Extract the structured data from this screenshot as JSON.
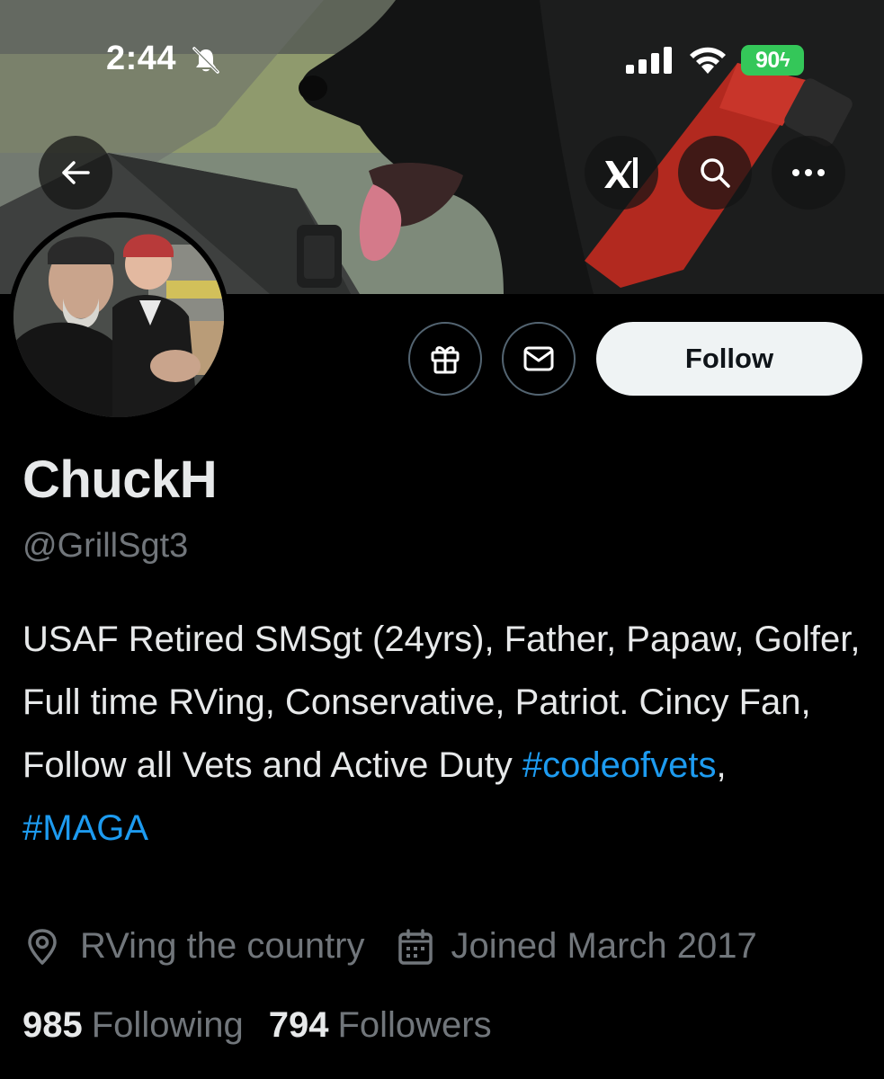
{
  "status_bar": {
    "time": "2:44",
    "battery": "90"
  },
  "banner": {
    "icons": [
      "back-arrow-icon",
      "grok-icon",
      "search-icon",
      "more-icon"
    ]
  },
  "actions": {
    "follow_label": "Follow",
    "icons": [
      "gift-icon",
      "mail-icon"
    ]
  },
  "profile": {
    "display_name": "ChuckH",
    "handle": "@GrillSgt3",
    "bio_text": "USAF Retired SMSgt (24yrs), Father, Papaw, Golfer, Full time RVing, Conservative, Patriot. Cincy Fan, Follow all Vets and Active Duty ",
    "bio_hashtag_1": "#codeofvets",
    "bio_separator": ",",
    "bio_hashtag_2": "#MAGA",
    "location": "RVing the country",
    "joined": "Joined March 2017",
    "following_count": "985",
    "following_label": "Following",
    "followers_count": "794",
    "followers_label": "Followers"
  },
  "colors": {
    "background": "#000000",
    "text_primary": "#e7e9ea",
    "text_secondary": "#71767b",
    "link": "#1d9bf0",
    "follow_button_bg": "#eff3f4",
    "battery_green": "#34c759"
  }
}
